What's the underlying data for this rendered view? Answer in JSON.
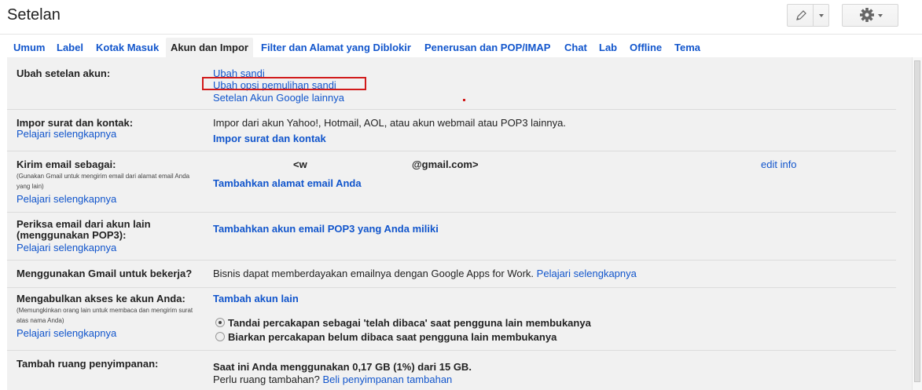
{
  "header": {
    "title": "Setelan",
    "icons": {
      "edit": "pencil-icon",
      "settings": "gear-icon",
      "dropdown": "chevron-down-icon"
    }
  },
  "tabs": [
    {
      "label": "Umum"
    },
    {
      "label": "Label"
    },
    {
      "label": "Kotak Masuk"
    },
    {
      "label": "Akun dan Impor"
    },
    {
      "label": "Filter dan Alamat yang Diblokir"
    },
    {
      "label": "Penerusan dan POP/IMAP"
    },
    {
      "label": "Chat"
    },
    {
      "label": "Lab"
    },
    {
      "label": "Offline"
    },
    {
      "label": "Tema"
    }
  ],
  "active_tab": "Akun dan Impor",
  "sections": {
    "account": {
      "label": "Ubah setelan akun:",
      "links": [
        "Ubah sandi",
        "Ubah opsi pemulihan sandi",
        "Setelan Akun Google lainnya"
      ]
    },
    "import": {
      "label": "Impor surat dan kontak:",
      "learn": "Pelajari selengkapnya",
      "text": "Impor dari akun Yahoo!, Hotmail, AOL, atau akun webmail atau POP3 lainnya.",
      "action": "Impor surat dan kontak"
    },
    "send_as": {
      "label": "Kirim email sebagai:",
      "note": "(Gunakan Gmail untuk mengirim email dari alamat email Anda yang lain)",
      "learn": "Pelajari selengkapnya",
      "email_prefix": "<w",
      "email_suffix": "@gmail.com>",
      "edit": "edit info",
      "action": "Tambahkan alamat email Anda"
    },
    "check_mail": {
      "label_line1": "Periksa email dari akun lain",
      "label_line2": "(menggunakan POP3):",
      "learn": "Pelajari selengkapnya",
      "action": "Tambahkan akun email POP3 yang Anda miliki"
    },
    "work": {
      "label": "Menggunakan Gmail untuk bekerja?",
      "text": "Bisnis dapat memberdayakan emailnya dengan Google Apps for Work.",
      "learn": "Pelajari selengkapnya"
    },
    "grant": {
      "label": "Mengabulkan akses ke akun Anda:",
      "note": "(Memungkinkan orang lain untuk membaca dan mengirim surat atas nama Anda)",
      "learn": "Pelajari selengkapnya",
      "action": "Tambah akun lain",
      "option1": "Tandai percakapan sebagai 'telah dibaca' saat pengguna lain membukanya",
      "option2": "Biarkan percakapan belum dibaca saat pengguna lain membukanya",
      "selected_option": 1
    },
    "storage": {
      "label": "Tambah ruang penyimpanan:",
      "usage": "Saat ini Anda menggunakan 0,17 GB (1%) dari 15 GB.",
      "need_more": "Perlu ruang tambahan?",
      "buy": "Beli penyimpanan tambahan"
    }
  }
}
